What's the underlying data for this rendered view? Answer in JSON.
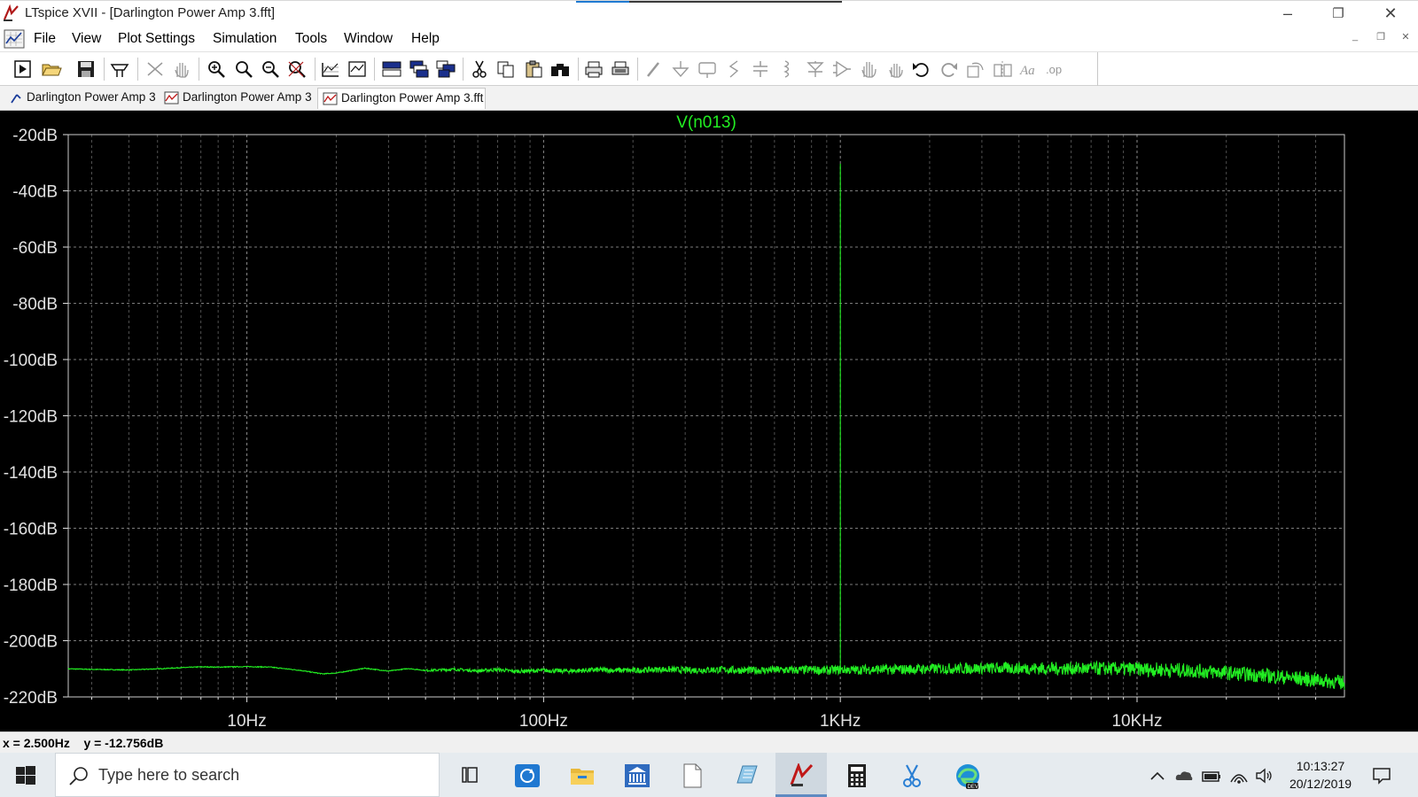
{
  "window": {
    "title": "LTspice XVII - [Darlington Power Amp 3.fft]",
    "controls": {
      "minimize": "–",
      "restore": "❐",
      "close": "✕"
    }
  },
  "menu": {
    "items": [
      "File",
      "View",
      "Plot Settings",
      "Simulation",
      "Tools",
      "Window",
      "Help"
    ],
    "mdi_controls": {
      "minimize": "_",
      "restore": "❐",
      "close": "✕"
    }
  },
  "toolbar": {
    "tools": [
      "new-schematic",
      "open",
      "save",
      "control-panel",
      "cut-wire",
      "pan",
      "zoom-area",
      "zoom-in",
      "zoom-out",
      "zoom-fit",
      "autorange",
      "manual-limits",
      "add-plot-pane",
      "tile-horizontal",
      "tile-vertical",
      "cut",
      "copy",
      "paste",
      "find",
      "print",
      "print-preview",
      "draw-wire",
      "ground",
      "label-net",
      "resistor",
      "capacitor",
      "inductor",
      "diode",
      "component",
      "move",
      "drag",
      "undo",
      "redo",
      "rotate",
      "mirror",
      "text",
      "spice-directive"
    ]
  },
  "tabs": [
    {
      "label": "Darlington Power Amp 3",
      "icon": "schematic-icon",
      "active": false
    },
    {
      "label": "Darlington Power Amp 3",
      "icon": "waveform-icon",
      "active": false
    },
    {
      "label": "Darlington Power Amp 3.fft",
      "icon": "fft-icon",
      "active": true
    }
  ],
  "status": {
    "text": "x = 2.500Hz    y = -12.756dB"
  },
  "taskbar": {
    "search_placeholder": "Type here to search",
    "time": "10:13:27",
    "date": "20/12/2019",
    "apps": [
      "task-view",
      "refresh-app",
      "file-explorer",
      "bank-app",
      "blank-document",
      "notepad-app",
      "ltspice",
      "calculator",
      "snipping-tool",
      "edge-dev"
    ]
  },
  "chart_data": {
    "type": "line",
    "title": "V(n013)",
    "x_scale": "log",
    "xlim": [
      2.5,
      50000
    ],
    "ylim": [
      -220,
      -20
    ],
    "x_tick_labels": [
      {
        "value": 10,
        "label": "10Hz"
      },
      {
        "value": 100,
        "label": "100Hz"
      },
      {
        "value": 1000,
        "label": "1KHz"
      },
      {
        "value": 10000,
        "label": "10KHz"
      }
    ],
    "y_tick_labels": [
      {
        "value": -20,
        "label": "-20dB"
      },
      {
        "value": -40,
        "label": "-40dB"
      },
      {
        "value": -60,
        "label": "-60dB"
      },
      {
        "value": -80,
        "label": "-80dB"
      },
      {
        "value": -100,
        "label": "-100dB"
      },
      {
        "value": -120,
        "label": "-120dB"
      },
      {
        "value": -140,
        "label": "-140dB"
      },
      {
        "value": -160,
        "label": "-160dB"
      },
      {
        "value": -180,
        "label": "-180dB"
      },
      {
        "value": -200,
        "label": "-200dB"
      },
      {
        "value": -220,
        "label": "-220dB"
      }
    ],
    "grid": true,
    "colors": {
      "background": "#000000",
      "trace": "#22ee22",
      "grid": "#9a9a9a",
      "axis_text": "#e0e0e0",
      "title": "#22ee22"
    },
    "series": [
      {
        "name": "V(n013)",
        "x": [
          2.5,
          3,
          4,
          5,
          6,
          7,
          8,
          10,
          12,
          15,
          18,
          20,
          25,
          30,
          35,
          40,
          50,
          60,
          70,
          80,
          100,
          120,
          150,
          200,
          250,
          300,
          400,
          500,
          600,
          700,
          800,
          900,
          950,
          1000,
          1050,
          1100,
          1200,
          1500,
          2000,
          3000,
          4000,
          5000,
          7000,
          10000,
          15000,
          20000,
          30000,
          40000,
          50000
        ],
        "y": [
          -210,
          -210.2,
          -210.4,
          -210,
          -209.6,
          -209.3,
          -209.4,
          -209.2,
          -209.4,
          -210.5,
          -211.8,
          -211.5,
          -209.8,
          -210.8,
          -209.9,
          -210.6,
          -210.2,
          -210.7,
          -210.3,
          -210.9,
          -210.6,
          -210.8,
          -210.4,
          -210.6,
          -210.2,
          -210.5,
          -210.3,
          -210.6,
          -210.4,
          -210.5,
          -210.3,
          -210.6,
          -210.4,
          -30.4,
          -210.3,
          -210.5,
          -210.2,
          -210.3,
          -210,
          -209.8,
          -209.8,
          -209.9,
          -209.9,
          -210.1,
          -210.6,
          -211.4,
          -212.8,
          -214,
          -215
        ]
      }
    ]
  }
}
